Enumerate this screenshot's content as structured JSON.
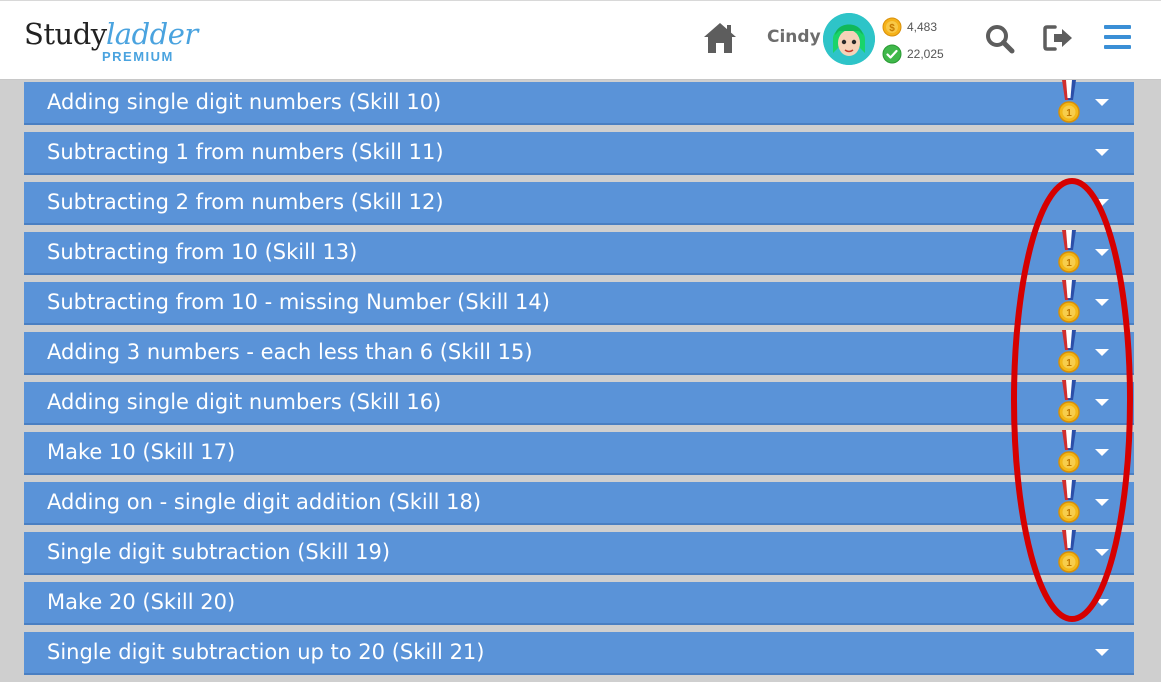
{
  "header": {
    "logo_study": "Study",
    "logo_ladder": "ladder",
    "logo_premium": "PREMIUM",
    "username": "Cindy",
    "coins": "4,483",
    "points": "22,025",
    "icons": {
      "home": "home-icon",
      "avatar": "avatar",
      "coin": "coin-icon",
      "check": "check-circle-icon",
      "search": "search-icon",
      "logout": "logout-icon",
      "menu": "hamburger-menu-icon"
    }
  },
  "skills": [
    {
      "label": "Adding single digit numbers (Skill 10)",
      "medal": true
    },
    {
      "label": "Subtracting 1 from numbers (Skill 11)",
      "medal": false
    },
    {
      "label": "Subtracting 2 from numbers (Skill 12)",
      "medal": false
    },
    {
      "label": "Subtracting from 10 (Skill 13)",
      "medal": true
    },
    {
      "label": "Subtracting from 10 - missing Number (Skill 14)",
      "medal": true
    },
    {
      "label": "Adding 3 numbers - each less than 6 (Skill 15)",
      "medal": true
    },
    {
      "label": "Adding single digit numbers (Skill 16)",
      "medal": true
    },
    {
      "label": "Make 10 (Skill 17)",
      "medal": true
    },
    {
      "label": "Adding on - single digit addition (Skill 18)",
      "medal": true
    },
    {
      "label": "Single digit subtraction (Skill 19)",
      "medal": true
    },
    {
      "label": "Make 20 (Skill 20)",
      "medal": false
    },
    {
      "label": "Single digit subtraction up to 20 (Skill 21)",
      "medal": false
    }
  ],
  "colors": {
    "header_bg": "#ffffff",
    "row_bg": "#5a93d8",
    "page_bg": "#cfcfcf",
    "accent": "#4aa3df",
    "annotation": "#d60000",
    "icon_gray": "#5d5d5d",
    "menu_blue": "#3a8fd6"
  }
}
